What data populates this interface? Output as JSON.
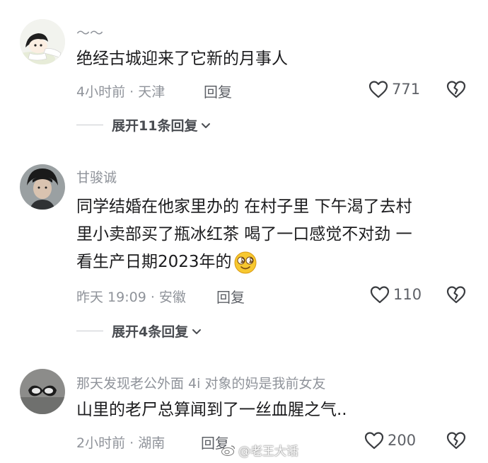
{
  "comments": [
    {
      "username": "～～",
      "text": "绝经古城迎来了它新的月事人",
      "meta": "4小时前 · 天津",
      "reply_label": "回复",
      "likes": "771",
      "expand_label": "展开11条回复"
    },
    {
      "username": "甘骏诚",
      "text_line1": "同学结婚在他家里办的 在村子里 下午渴了去村",
      "text_line2": "里小卖部买了瓶冰红茶 喝了一口感觉不对劲 一",
      "text_line3": "看生产日期2023年的",
      "meta": "昨天 19:09 · 安徽",
      "reply_label": "回复",
      "likes": "110",
      "expand_label": "展开4条回复"
    },
    {
      "username": "那天发现老公外面 4i 对象的妈是我前女友",
      "text": "山里的老尸总算闻到了一丝血腥之气..",
      "meta": "2小时前 · 湖南",
      "reply_label": "回复",
      "likes": "200"
    }
  ],
  "watermark": "@老王大话",
  "icons": [
    "heart-outline-icon",
    "broken-heart-icon",
    "chevron-down-icon",
    "weibo-logo-icon",
    "dizzy-face-emoji"
  ],
  "colors": {
    "text": "#1b1b1d",
    "muted": "#8f939a",
    "action": "#5e6167"
  }
}
